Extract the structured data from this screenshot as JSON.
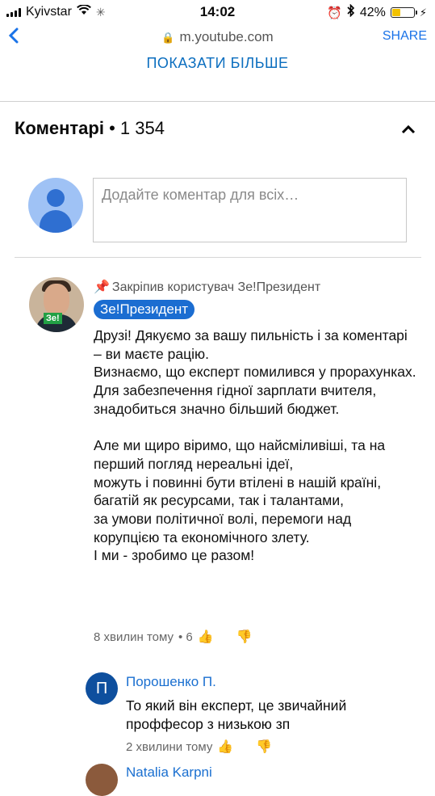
{
  "status_bar": {
    "carrier": "Kyivstar",
    "time": "14:02",
    "battery_percent": "42%",
    "battery_level": 0.42
  },
  "browser": {
    "back_icon": "chevron-left-icon",
    "url": "m.youtube.com",
    "share_label": "SHARE"
  },
  "show_more_label": "ПОКАЗАТИ БІЛЬШЕ",
  "comments": {
    "title": "Коментарі",
    "count": "• 1 354",
    "input_placeholder": "Додайте коментар для всіх…"
  },
  "pinned_comment": {
    "pinned_label": "Закріпив користувач Зе!Президент",
    "author": "Зе!Президент",
    "avatar_logo": "Зе!",
    "text": "Друзі! Дякуємо за вашу пильність і за коментарі – ви маєте рацію.\nВизнаємо, що експерт помилився у прорахунках.\nДля забезпечення гідної зарплати вчителя, знадобиться значно більший бюджет.\n\nАле ми щиро віримо, що найсміливіші, та на перший погляд нереальні ідеї,\nможуть і повинні бути втілені в нашій країні, багатій як ресурсами, так і талантами,\nза умови політичної волі, перемоги над корупцією та економічного злету.\nІ ми - зробимо це разом!",
    "time": "8 хвилин тому",
    "likes": "• 6"
  },
  "reply": {
    "avatar_letter": "П",
    "author": "Порошенко П.",
    "text": "То який він експерт, це звичайний\nпроффесор з низькою зп",
    "time": "2 хвилини тому"
  },
  "next_reply": {
    "author": "Natalia Karpni"
  }
}
